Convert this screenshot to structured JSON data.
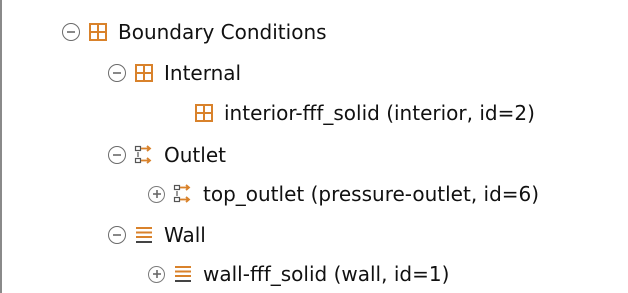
{
  "tree": {
    "boundary_conditions": {
      "label": "Boundary Conditions",
      "icon": "grid-table-icon",
      "state": "expanded"
    },
    "internal": {
      "label": "Internal",
      "icon": "grid-table-icon",
      "state": "expanded",
      "children": [
        {
          "label": "interior-fff_solid (interior, id=2)",
          "icon": "grid-table-icon"
        }
      ]
    },
    "outlet": {
      "label": "Outlet",
      "icon": "outlet-flow-icon",
      "state": "expanded",
      "children": [
        {
          "label": "top_outlet (pressure-outlet, id=6)",
          "icon": "outlet-flow-icon",
          "state": "collapsed"
        }
      ]
    },
    "wall": {
      "label": "Wall",
      "icon": "wall-lines-icon",
      "state": "expanded",
      "children": [
        {
          "label": "wall-fff_solid (wall, id=1)",
          "icon": "wall-lines-icon",
          "state": "collapsed"
        }
      ]
    }
  },
  "colors": {
    "icon_orange": "#d9822b",
    "toggle_gray": "#6b6b6b",
    "text": "#111111",
    "border": "#8a8a8a"
  }
}
